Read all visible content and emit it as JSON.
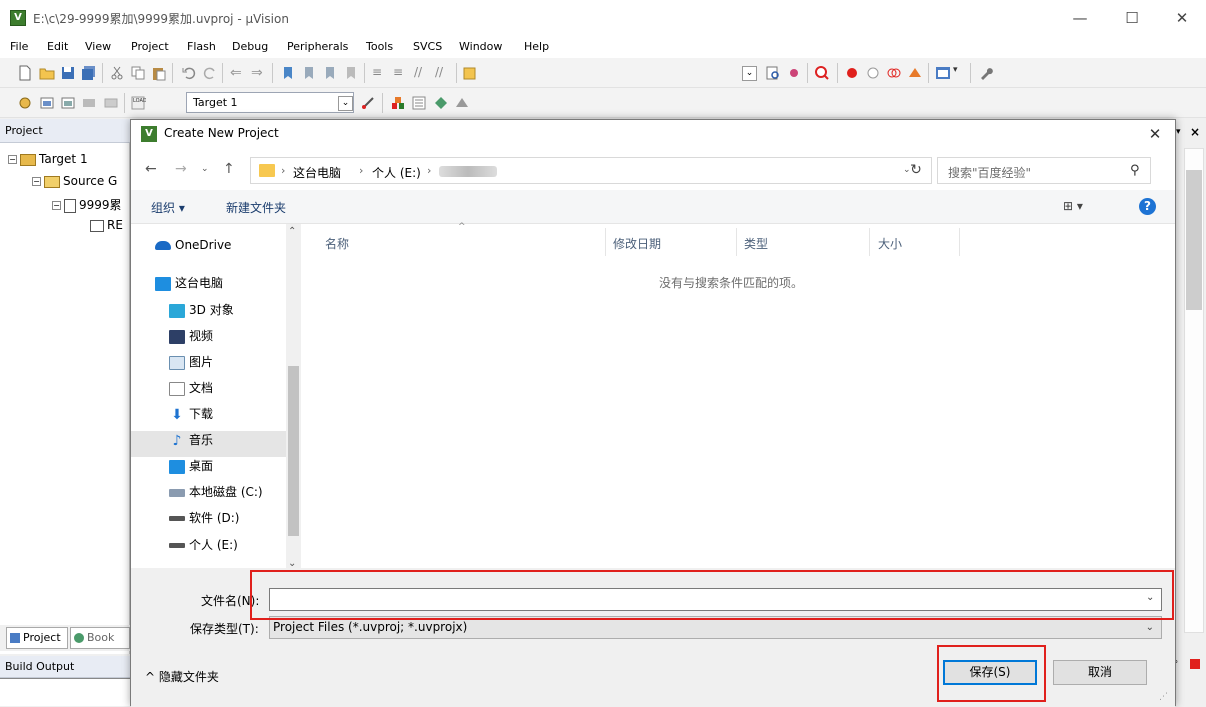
{
  "window": {
    "title": "E:\\c\\29-9999累加\\9999累加.uvproj - µVision"
  },
  "menu": {
    "items": [
      "File",
      "Edit",
      "View",
      "Project",
      "Flash",
      "Debug",
      "Peripherals",
      "Tools",
      "SVCS",
      "Window",
      "Help"
    ]
  },
  "toolbar2": {
    "target": "Target 1"
  },
  "project_pane": {
    "header": "Project",
    "tree": [
      "Target 1",
      "Source G",
      "9999累",
      "RE"
    ],
    "tabs": [
      "Project",
      "Book"
    ]
  },
  "build_output": {
    "header": "Build Output"
  },
  "dialog": {
    "title": "Create New Project",
    "breadcrumb": [
      "这台电脑",
      "个人 (E:)"
    ],
    "search_placeholder": "搜索\"百度经验\"",
    "commands": {
      "organize": "组织 ▾",
      "new_folder": "新建文件夹"
    },
    "nav_items": [
      "OneDrive",
      "这台电脑",
      "3D 对象",
      "视频",
      "图片",
      "文档",
      "下载",
      "音乐",
      "桌面",
      "本地磁盘 (C:)",
      "软件 (D:)",
      "个人 (E:)"
    ],
    "columns": [
      "名称",
      "修改日期",
      "类型",
      "大小"
    ],
    "empty_message": "没有与搜索条件匹配的项。",
    "filename_label": "文件名(N):",
    "filename_value": "",
    "filetype_label": "保存类型(T):",
    "filetype_value": "Project Files (*.uvproj; *.uvprojx)",
    "hide_folders": "隐藏文件夹",
    "save_button": "保存(S)",
    "cancel_button": "取消"
  },
  "colors": {
    "highlight": "#e0201c",
    "accent": "#0078d7"
  }
}
